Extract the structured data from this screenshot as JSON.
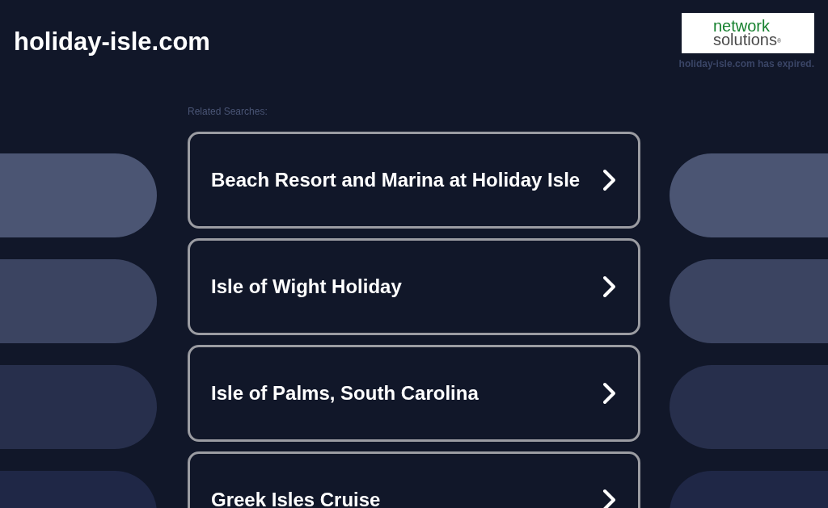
{
  "header": {
    "site_title": "holiday-isle.com",
    "logo": {
      "line_1": "network",
      "line_2": "solutions$^{®}$"
    },
    "notice": "holiday-isle.com has expired."
  },
  "related_searches": {
    "label": "Related Searches:",
    "links": [
      {
        "text": "Beach Resort and Marina at Holiday Isle"
      },
      {
        "text": "Isle of Wight Holiday"
      },
      {
        "text": "Isle of Palms, South Carolina"
      },
      {
        "text": "Greek Isles Cruise"
      }
    ]
  }
}
